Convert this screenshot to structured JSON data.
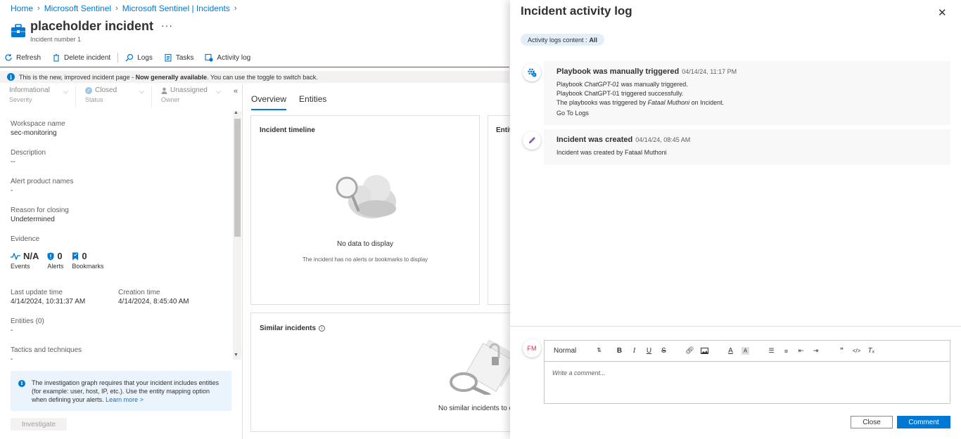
{
  "breadcrumb": [
    {
      "label": "Home"
    },
    {
      "label": "Microsoft Sentinel"
    },
    {
      "label": "Microsoft Sentinel | Incidents"
    }
  ],
  "header": {
    "title": "placeholder incident",
    "more": "···",
    "subtitle": "Incident number 1"
  },
  "toolbar": {
    "refresh": "Refresh",
    "delete": "Delete incident",
    "logs": "Logs",
    "tasks": "Tasks",
    "activity_log": "Activity log"
  },
  "info_bar": {
    "text_pre": "This is the new, improved incident page - ",
    "text_bold": "Now generally available",
    "text_post": ". You can use the toggle to switch back."
  },
  "dropdowns": {
    "severity": {
      "value": "Informational",
      "label": "Severity"
    },
    "status": {
      "value": "Closed",
      "label": "Status"
    },
    "owner": {
      "value": "Unassigned",
      "label": "Owner"
    }
  },
  "details": {
    "workspace": {
      "label": "Workspace name",
      "value": "sec-monitoring"
    },
    "description": {
      "label": "Description",
      "value": "--"
    },
    "alert_products": {
      "label": "Alert product names",
      "value": "-"
    },
    "reason": {
      "label": "Reason for closing",
      "value": "Undetermined"
    },
    "evidence_label": "Evidence",
    "events": {
      "value": "N/A",
      "label": "Events"
    },
    "alerts": {
      "value": "0",
      "label": "Alerts"
    },
    "bookmarks": {
      "value": "0",
      "label": "Bookmarks"
    },
    "last_update": {
      "label": "Last update time",
      "value": "4/14/2024, 10:31:37 AM"
    },
    "creation": {
      "label": "Creation time",
      "value": "4/14/2024, 8:45:40 AM"
    },
    "entities": {
      "label": "Entities (0)",
      "value": "-"
    },
    "tactics": {
      "label": "Tactics and techniques",
      "value": "-"
    }
  },
  "note": {
    "text": "The investigation graph requires that your incident includes entities (for example: user, host, IP, etc.). Use the entity mapping option when defining your alerts.",
    "link": "Learn more >"
  },
  "investigate_label": "Investigate",
  "tabs": [
    {
      "label": "Overview"
    },
    {
      "label": "Entities"
    }
  ],
  "timeline": {
    "title": "Incident timeline",
    "empty_title": "No data to display",
    "empty_sub": "The incident has no alerts or bookmarks to display"
  },
  "entities_card": {
    "title": "Entit"
  },
  "similar": {
    "title": "Similar incidents",
    "empty": "No similar incidents to d"
  },
  "activity_panel": {
    "title": "Incident activity log",
    "filter_label": "Activity logs content :",
    "filter_value": "All",
    "entries": [
      {
        "title": "Playbook was manually triggered",
        "time": "04/14/24, 11:17 PM",
        "line1_pre": "Playbook ",
        "line1_em": "ChatGPT-01",
        "line1_post": " was manually triggered.",
        "line2": "Playbook ChatGPT-01 triggered successfully.",
        "line3_pre": "The playbooks was triggered by ",
        "line3_em": "Fataal Muthoni",
        "line3_post": " on Incident.",
        "link": "Go To Logs"
      },
      {
        "title": "Incident was created",
        "time": "04/14/24, 08:45 AM",
        "line1": "Incident was created by Fataal Muthoni"
      }
    ],
    "avatar_initials": "FM",
    "format_select": "Normal",
    "placeholder": "Write a comment...",
    "close_label": "Close",
    "comment_label": "Comment"
  },
  "colors": {
    "accent": "#0078d4",
    "info_bg": "#ebf3fc",
    "avatar_text": "#c4314b"
  }
}
